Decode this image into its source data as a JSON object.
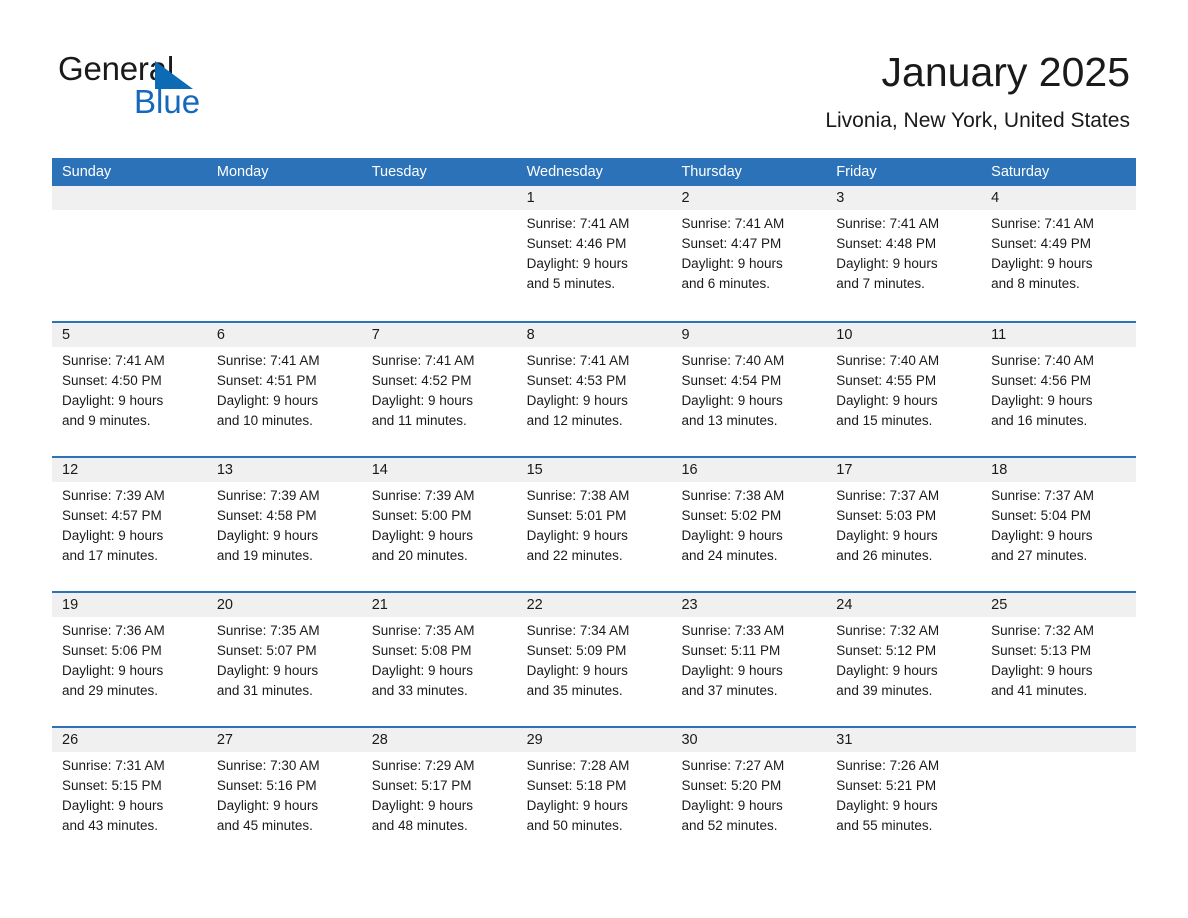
{
  "brand": {
    "name_part1": "General",
    "name_part2": "Blue",
    "triangle_icon": "triangle-logo-icon",
    "accent_color": "#0d6ab5",
    "blue_text_color": "#1469bd"
  },
  "header": {
    "month_title": "January 2025",
    "location": "Livonia, New York, United States"
  },
  "theme": {
    "header_blue": "#2c72b8",
    "daynum_band": "#f0f0f0",
    "text": "#1a1a1a"
  },
  "calendar": {
    "weekday_headers": [
      "Sunday",
      "Monday",
      "Tuesday",
      "Wednesday",
      "Thursday",
      "Friday",
      "Saturday"
    ],
    "weeks": [
      [
        {
          "day": "",
          "lines": [
            "",
            "",
            "",
            ""
          ]
        },
        {
          "day": "",
          "lines": [
            "",
            "",
            "",
            ""
          ]
        },
        {
          "day": "",
          "lines": [
            "",
            "",
            "",
            ""
          ]
        },
        {
          "day": "1",
          "lines": [
            "Sunrise: 7:41 AM",
            "Sunset: 4:46 PM",
            "Daylight: 9 hours",
            "and 5 minutes."
          ]
        },
        {
          "day": "2",
          "lines": [
            "Sunrise: 7:41 AM",
            "Sunset: 4:47 PM",
            "Daylight: 9 hours",
            "and 6 minutes."
          ]
        },
        {
          "day": "3",
          "lines": [
            "Sunrise: 7:41 AM",
            "Sunset: 4:48 PM",
            "Daylight: 9 hours",
            "and 7 minutes."
          ]
        },
        {
          "day": "4",
          "lines": [
            "Sunrise: 7:41 AM",
            "Sunset: 4:49 PM",
            "Daylight: 9 hours",
            "and 8 minutes."
          ]
        }
      ],
      [
        {
          "day": "5",
          "lines": [
            "Sunrise: 7:41 AM",
            "Sunset: 4:50 PM",
            "Daylight: 9 hours",
            "and 9 minutes."
          ]
        },
        {
          "day": "6",
          "lines": [
            "Sunrise: 7:41 AM",
            "Sunset: 4:51 PM",
            "Daylight: 9 hours",
            "and 10 minutes."
          ]
        },
        {
          "day": "7",
          "lines": [
            "Sunrise: 7:41 AM",
            "Sunset: 4:52 PM",
            "Daylight: 9 hours",
            "and 11 minutes."
          ]
        },
        {
          "day": "8",
          "lines": [
            "Sunrise: 7:41 AM",
            "Sunset: 4:53 PM",
            "Daylight: 9 hours",
            "and 12 minutes."
          ]
        },
        {
          "day": "9",
          "lines": [
            "Sunrise: 7:40 AM",
            "Sunset: 4:54 PM",
            "Daylight: 9 hours",
            "and 13 minutes."
          ]
        },
        {
          "day": "10",
          "lines": [
            "Sunrise: 7:40 AM",
            "Sunset: 4:55 PM",
            "Daylight: 9 hours",
            "and 15 minutes."
          ]
        },
        {
          "day": "11",
          "lines": [
            "Sunrise: 7:40 AM",
            "Sunset: 4:56 PM",
            "Daylight: 9 hours",
            "and 16 minutes."
          ]
        }
      ],
      [
        {
          "day": "12",
          "lines": [
            "Sunrise: 7:39 AM",
            "Sunset: 4:57 PM",
            "Daylight: 9 hours",
            "and 17 minutes."
          ]
        },
        {
          "day": "13",
          "lines": [
            "Sunrise: 7:39 AM",
            "Sunset: 4:58 PM",
            "Daylight: 9 hours",
            "and 19 minutes."
          ]
        },
        {
          "day": "14",
          "lines": [
            "Sunrise: 7:39 AM",
            "Sunset: 5:00 PM",
            "Daylight: 9 hours",
            "and 20 minutes."
          ]
        },
        {
          "day": "15",
          "lines": [
            "Sunrise: 7:38 AM",
            "Sunset: 5:01 PM",
            "Daylight: 9 hours",
            "and 22 minutes."
          ]
        },
        {
          "day": "16",
          "lines": [
            "Sunrise: 7:38 AM",
            "Sunset: 5:02 PM",
            "Daylight: 9 hours",
            "and 24 minutes."
          ]
        },
        {
          "day": "17",
          "lines": [
            "Sunrise: 7:37 AM",
            "Sunset: 5:03 PM",
            "Daylight: 9 hours",
            "and 26 minutes."
          ]
        },
        {
          "day": "18",
          "lines": [
            "Sunrise: 7:37 AM",
            "Sunset: 5:04 PM",
            "Daylight: 9 hours",
            "and 27 minutes."
          ]
        }
      ],
      [
        {
          "day": "19",
          "lines": [
            "Sunrise: 7:36 AM",
            "Sunset: 5:06 PM",
            "Daylight: 9 hours",
            "and 29 minutes."
          ]
        },
        {
          "day": "20",
          "lines": [
            "Sunrise: 7:35 AM",
            "Sunset: 5:07 PM",
            "Daylight: 9 hours",
            "and 31 minutes."
          ]
        },
        {
          "day": "21",
          "lines": [
            "Sunrise: 7:35 AM",
            "Sunset: 5:08 PM",
            "Daylight: 9 hours",
            "and 33 minutes."
          ]
        },
        {
          "day": "22",
          "lines": [
            "Sunrise: 7:34 AM",
            "Sunset: 5:09 PM",
            "Daylight: 9 hours",
            "and 35 minutes."
          ]
        },
        {
          "day": "23",
          "lines": [
            "Sunrise: 7:33 AM",
            "Sunset: 5:11 PM",
            "Daylight: 9 hours",
            "and 37 minutes."
          ]
        },
        {
          "day": "24",
          "lines": [
            "Sunrise: 7:32 AM",
            "Sunset: 5:12 PM",
            "Daylight: 9 hours",
            "and 39 minutes."
          ]
        },
        {
          "day": "25",
          "lines": [
            "Sunrise: 7:32 AM",
            "Sunset: 5:13 PM",
            "Daylight: 9 hours",
            "and 41 minutes."
          ]
        }
      ],
      [
        {
          "day": "26",
          "lines": [
            "Sunrise: 7:31 AM",
            "Sunset: 5:15 PM",
            "Daylight: 9 hours",
            "and 43 minutes."
          ]
        },
        {
          "day": "27",
          "lines": [
            "Sunrise: 7:30 AM",
            "Sunset: 5:16 PM",
            "Daylight: 9 hours",
            "and 45 minutes."
          ]
        },
        {
          "day": "28",
          "lines": [
            "Sunrise: 7:29 AM",
            "Sunset: 5:17 PM",
            "Daylight: 9 hours",
            "and 48 minutes."
          ]
        },
        {
          "day": "29",
          "lines": [
            "Sunrise: 7:28 AM",
            "Sunset: 5:18 PM",
            "Daylight: 9 hours",
            "and 50 minutes."
          ]
        },
        {
          "day": "30",
          "lines": [
            "Sunrise: 7:27 AM",
            "Sunset: 5:20 PM",
            "Daylight: 9 hours",
            "and 52 minutes."
          ]
        },
        {
          "day": "31",
          "lines": [
            "Sunrise: 7:26 AM",
            "Sunset: 5:21 PM",
            "Daylight: 9 hours",
            "and 55 minutes."
          ]
        },
        {
          "day": "",
          "lines": [
            "",
            "",
            "",
            ""
          ]
        }
      ]
    ]
  }
}
